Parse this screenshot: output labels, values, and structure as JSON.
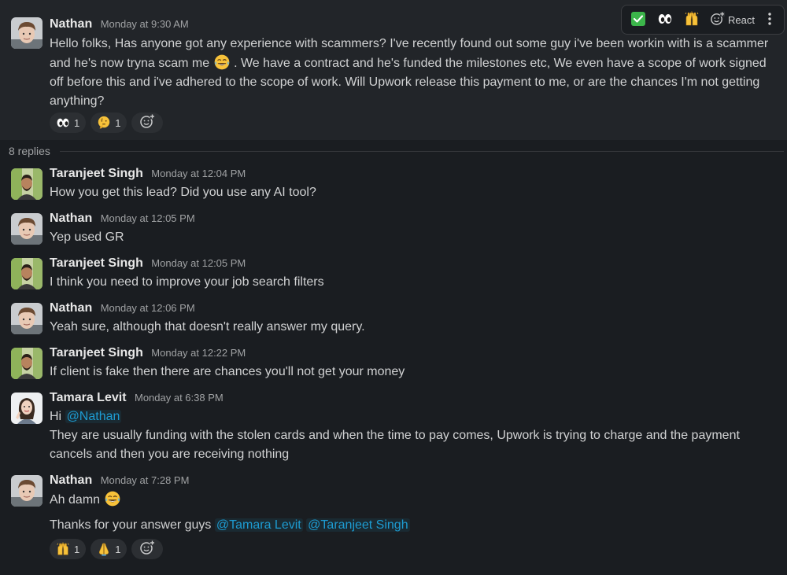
{
  "parent": {
    "author": "Nathan",
    "time": "Monday at 9:30 AM",
    "text_1": "Hello folks, Has anyone got any experience with scammers? I've recently found out some guy i've been workin with is a scammer and he's now tryna scam me",
    "text_2": ". We have a contract and he's funded the milestones etc, We even have a scope of work signed off before this and i've adhered to the scope of work. Will Upwork release this payment to me, or are the chances I'm not getting anything?",
    "reactions": [
      {
        "icon": "eyes-emoji",
        "count": "1"
      },
      {
        "icon": "thinking-face-emoji",
        "count": "1"
      }
    ]
  },
  "toolbar": {
    "react_label": "React",
    "icons": [
      "check-mark-emoji",
      "eyes-emoji",
      "raised-hands-emoji",
      "add-reaction-icon",
      "more-vertical-icon"
    ]
  },
  "replies": {
    "label": "8 replies"
  },
  "messages": [
    {
      "author": "Taranjeet Singh",
      "time": "Monday at 12:04 PM",
      "text": "How you get this lead? Did you use any AI tool?"
    },
    {
      "author": "Nathan",
      "time": "Monday at 12:05 PM",
      "text": "Yep used GR"
    },
    {
      "author": "Taranjeet Singh",
      "time": "Monday at 12:05 PM",
      "text": "I think you need to improve your job search filters"
    },
    {
      "author": "Nathan",
      "time": "Monday at 12:06 PM",
      "text": "Yeah sure, although that doesn't really answer my query."
    },
    {
      "author": "Taranjeet Singh",
      "time": "Monday at 12:22 PM",
      "text": "If client is fake then there are chances you'll not get your money"
    },
    {
      "author": "Tamara Levit",
      "time": "Monday at 6:38 PM",
      "greeting": "Hi",
      "mention": "@Nathan",
      "text": "They are usually funding with the stolen cards and when the time to pay comes, Upwork is trying to charge and the payment cancels and then you are receiving nothing"
    },
    {
      "author": "Nathan",
      "time": "Monday at 7:28 PM",
      "text": "Ah damn",
      "text_2": "Thanks for your answer guys",
      "mention_1": "@Tamara Levit",
      "mention_2": "@Taranjeet Singh",
      "reactions": [
        {
          "icon": "raised-hands-emoji",
          "count": "1"
        },
        {
          "icon": "folded-hands-emoji",
          "count": "1"
        }
      ]
    }
  ],
  "colors": {
    "background": "#1a1d21",
    "parent_background": "#222529",
    "mention": "#1d9bd1",
    "text": "#d1d2d3"
  }
}
